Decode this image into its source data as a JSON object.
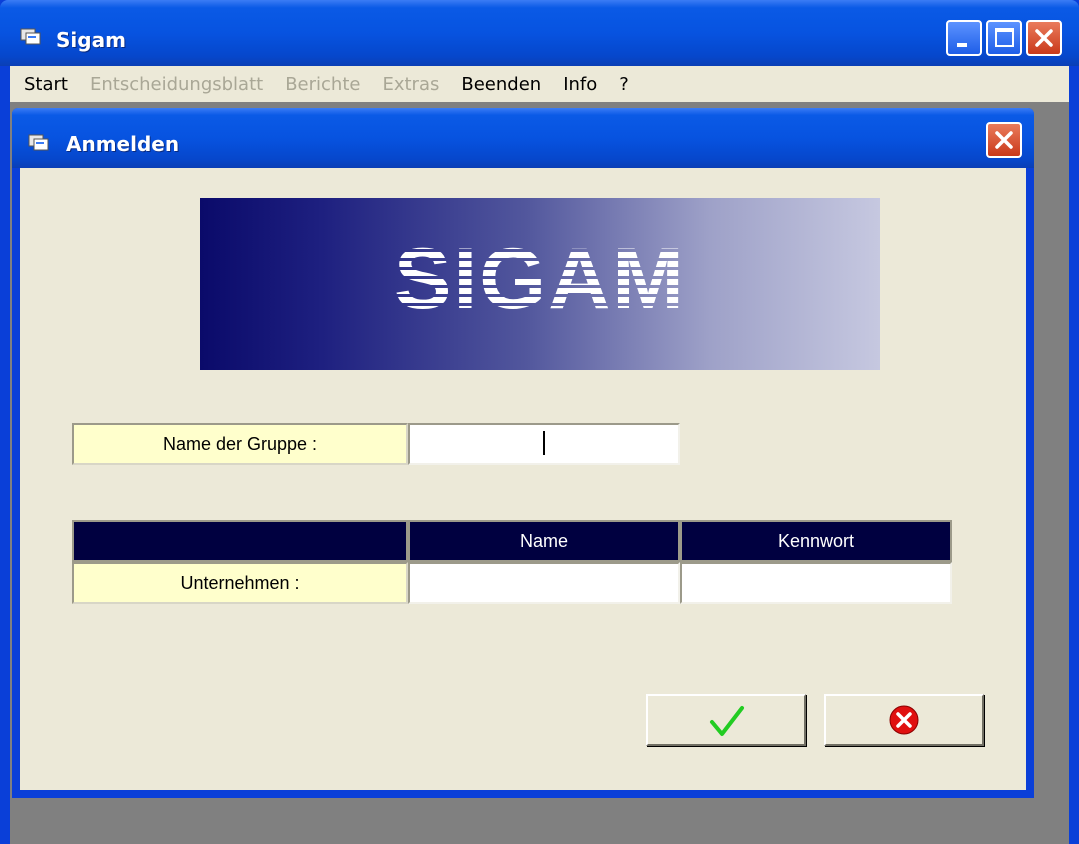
{
  "window": {
    "title": "Sigam"
  },
  "menu": {
    "items": [
      {
        "label": "Start",
        "enabled": true
      },
      {
        "label": "Entscheidungsblatt",
        "enabled": false
      },
      {
        "label": "Berichte",
        "enabled": false
      },
      {
        "label": "Extras",
        "enabled": false
      },
      {
        "label": "Beenden",
        "enabled": true
      },
      {
        "label": "Info",
        "enabled": true
      },
      {
        "label": "?",
        "enabled": true
      }
    ]
  },
  "dialog": {
    "title": "Anmelden",
    "banner_text": "SIGAM",
    "group_label": "Name der Gruppe :",
    "group_value": "",
    "table": {
      "headers": [
        "",
        "Name",
        "Kennwort"
      ],
      "row_label": "Unternehmen :",
      "name_value": "",
      "password_value": ""
    },
    "ok_icon": "checkmark-icon",
    "cancel_icon": "cancel-x-icon"
  },
  "colors": {
    "title_bar": "#0753e0",
    "dialog_bg": "#ece9d8",
    "label_bg": "#ffffcc",
    "header_bg": "#000040",
    "ok_green": "#22cc22",
    "cancel_red": "#e01010"
  }
}
